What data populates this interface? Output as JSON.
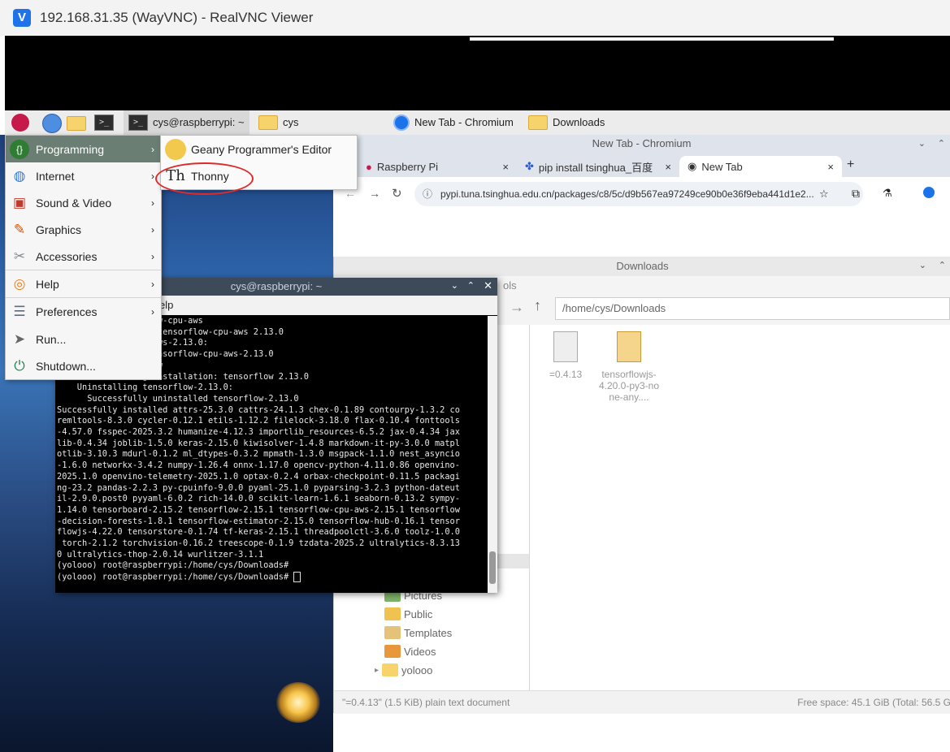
{
  "vnc": {
    "title": "192.168.31.35 (WayVNC) - RealVNC Viewer",
    "logo": "V"
  },
  "taskbar": {
    "terminal_window": "cys@raspberrypi: ~",
    "folder_window": "cys",
    "chromium_window": "New Tab - Chromium",
    "downloads_window": "Downloads"
  },
  "start_menu": {
    "items": [
      {
        "label": "Programming",
        "icon": "code-icon"
      },
      {
        "label": "Internet",
        "icon": "globe-icon"
      },
      {
        "label": "Sound & Video",
        "icon": "film-icon"
      },
      {
        "label": "Graphics",
        "icon": "paint-icon"
      },
      {
        "label": "Accessories",
        "icon": "tools-icon"
      },
      {
        "label": "Help",
        "icon": "lifebuoy-icon"
      },
      {
        "label": "Preferences",
        "icon": "settings-icon"
      },
      {
        "label": "Run...",
        "icon": "paper-plane-icon"
      },
      {
        "label": "Shutdown...",
        "icon": "exit-icon"
      }
    ]
  },
  "submenu": {
    "items": [
      {
        "label": "Geany Programmer's Editor",
        "icon": "geany-icon"
      },
      {
        "label": "Thonny",
        "icon": "thonny-icon"
      }
    ]
  },
  "chromium": {
    "title": "New Tab - Chromium",
    "tabs": [
      {
        "label": "Raspberry Pi"
      },
      {
        "label": "pip install tsinghua_百度"
      },
      {
        "label": "New Tab"
      }
    ],
    "url": "pypi.tuna.tsinghua.edu.cn/packages/c8/5c/d9b567ea97249ce90b0e36f9eba441d1e2..."
  },
  "file_manager": {
    "title": "Downloads",
    "menu_fragment": "ols",
    "path": "/home/cys/Downloads",
    "places": [
      "Pictures",
      "Public",
      "Templates",
      "Videos",
      "yolooo"
    ],
    "files": [
      {
        "name": "=0.4.13",
        "type": "text"
      },
      {
        "name": "tensorflowjs-4.20.0-py3-none-any....",
        "type": "archive"
      }
    ],
    "status_left": "\"=0.4.13\" (1.5 KiB) plain text document",
    "status_right": "Free space: 45.1 GiB (Total: 56.5 G"
  },
  "terminal": {
    "title": "cys@raspberrypi: ~",
    "menu_fragment": "elp",
    "lines": [
      "      all: tensorflow-cpu-aws",
      "      installation: tensorflow-cpu-aws 2.13.0",
      "      nsorflow-cpu-aws-2.13.0:",
      "      uninstalled tensorflow-cpu-aws-2.13.0",
      "      all: tensorflow",
      "    Found existing installation: tensorflow 2.13.0",
      "    Uninstalling tensorflow-2.13.0:",
      "      Successfully uninstalled tensorflow-2.13.0",
      "Successfully installed attrs-25.3.0 cattrs-24.1.3 chex-0.1.89 contourpy-1.3.2 co",
      "remltools-8.3.0 cycler-0.12.1 etils-1.12.2 filelock-3.18.0 flax-0.10.4 fonttools",
      "-4.57.0 fsspec-2025.3.2 humanize-4.12.3 importlib_resources-6.5.2 jax-0.4.34 jax",
      "lib-0.4.34 joblib-1.5.0 keras-2.15.0 kiwisolver-1.4.8 markdown-it-py-3.0.0 matpl",
      "otlib-3.10.3 mdurl-0.1.2 ml_dtypes-0.3.2 mpmath-1.3.0 msgpack-1.1.0 nest_asyncio",
      "-1.6.0 networkx-3.4.2 numpy-1.26.4 onnx-1.17.0 opencv-python-4.11.0.86 openvino-",
      "2025.1.0 openvino-telemetry-2025.1.0 optax-0.2.4 orbax-checkpoint-0.11.5 packagi",
      "ng-23.2 pandas-2.2.3 py-cpuinfo-9.0.0 pyaml-25.1.0 pyparsing-3.2.3 python-dateut",
      "il-2.9.0.post0 pyyaml-6.0.2 rich-14.0.0 scikit-learn-1.6.1 seaborn-0.13.2 sympy-",
      "1.14.0 tensorboard-2.15.2 tensorflow-2.15.1 tensorflow-cpu-aws-2.15.1 tensorflow",
      "-decision-forests-1.8.1 tensorflow-estimator-2.15.0 tensorflow-hub-0.16.1 tensor",
      "flowjs-4.22.0 tensorstore-0.1.74 tf-keras-2.15.1 threadpoolctl-3.6.0 toolz-1.0.0",
      " torch-2.1.2 torchvision-0.16.2 treescope-0.1.9 tzdata-2025.2 ultralytics-8.3.13",
      "0 ultralytics-thop-2.0.14 wurlitzer-3.1.1",
      "(yolooo) root@raspberrypi:/home/cys/Downloads#",
      "(yolooo) root@raspberrypi:/home/cys/Downloads# "
    ]
  }
}
